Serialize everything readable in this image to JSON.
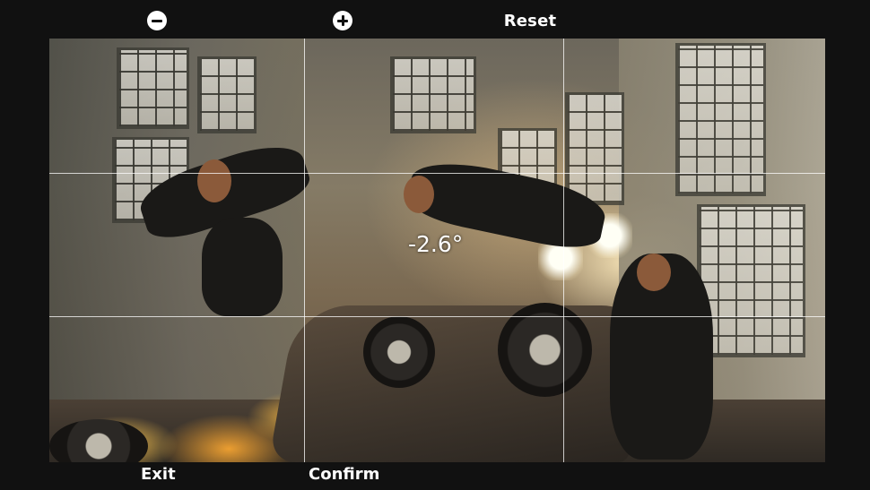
{
  "toolbar": {
    "zoom_out_icon": "minus-circle-icon",
    "zoom_in_icon": "plus-circle-icon",
    "reset_label": "Reset"
  },
  "viewport": {
    "angle_value": "-2.6°",
    "grid": "3x3"
  },
  "footer": {
    "exit_label": "Exit",
    "confirm_label": "Confirm"
  },
  "colors": {
    "background": "#0d0d0d",
    "text": "#ffffff",
    "grid_line": "#ffffff"
  }
}
